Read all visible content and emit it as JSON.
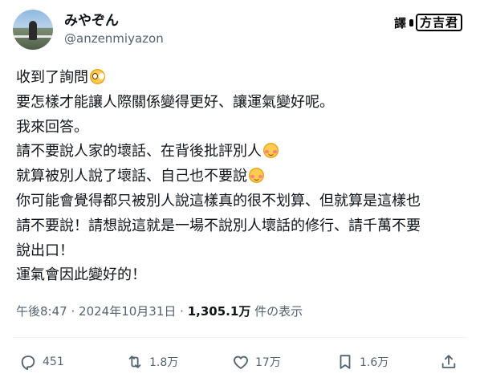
{
  "author": {
    "display_name": "みやぞん",
    "handle": "@anzenmiyazon"
  },
  "watermark": {
    "prefix": "譯",
    "name": "方吉君"
  },
  "tweet": {
    "lines": [
      {
        "text": "收到了詢問",
        "emoji": "pleading-face-emoji"
      },
      {
        "text": "要怎樣才能讓人際關係變得更好、讓運氣變好呢。"
      },
      {
        "text": "我來回答。"
      },
      {
        "text": "請不要說人家的壞話、在背後批評別人",
        "emoji": "blush-face-emoji"
      },
      {
        "text": "就算被別人說了壞話、自己也不要說",
        "emoji": "blush-face-emoji"
      },
      {
        "text": "你可能會覺得都只被別人說這樣真的很不划算、但就算是這樣也"
      },
      {
        "text": "請不要說！請想說這就是一場不說別人壞話的修行、請千萬不要"
      },
      {
        "text": "說出口！"
      },
      {
        "text": "運氣會因此變好的！"
      }
    ]
  },
  "meta": {
    "time": "午後8:47",
    "date": "2024年10月31日",
    "separator": "·",
    "views_count": "1,305.1万",
    "views_label": "件の表示"
  },
  "actions": {
    "reply": {
      "icon": "reply-icon",
      "count": "451"
    },
    "retweet": {
      "icon": "retweet-icon",
      "count": "1.8万"
    },
    "like": {
      "icon": "heart-icon",
      "count": "17万"
    },
    "bookmark": {
      "icon": "bookmark-icon",
      "count": "1.6万"
    },
    "share": {
      "icon": "share-icon"
    }
  },
  "colors": {
    "text_primary": "#0f1419",
    "text_secondary": "#536471",
    "divider": "#eff3f4"
  }
}
